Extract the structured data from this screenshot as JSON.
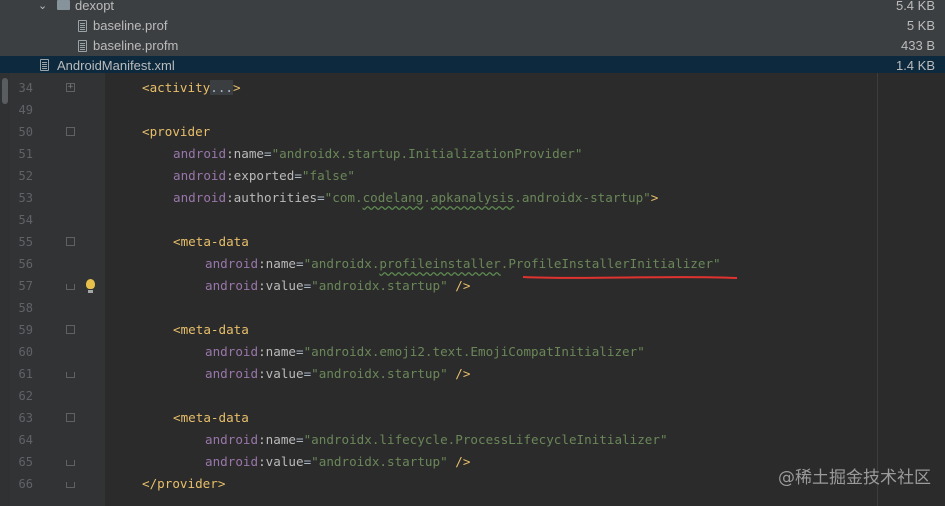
{
  "project_tree": {
    "rows": [
      {
        "name": "dexopt",
        "size": "5.4 KB",
        "type": "folder"
      },
      {
        "name": "baseline.prof",
        "size": "5 KB",
        "type": "file"
      },
      {
        "name": "baseline.profm",
        "size": "433 B",
        "type": "file"
      },
      {
        "name": "AndroidManifest.xml",
        "size": "1.4 KB",
        "type": "file"
      }
    ]
  },
  "editor": {
    "lines": [
      {
        "num": "34",
        "tokens": [
          {
            "t": "<activity",
            "c": "tag"
          },
          {
            "t": "...",
            "c": "dots"
          },
          {
            "t": ">",
            "c": "tag"
          }
        ]
      },
      {
        "num": "49",
        "tokens": []
      },
      {
        "num": "50",
        "tokens": [
          {
            "t": "<provider",
            "c": "tag"
          }
        ]
      },
      {
        "num": "51",
        "tokens": [
          {
            "t": "android",
            "c": "ns"
          },
          {
            "t": ":name",
            "c": "attr"
          },
          {
            "t": "=",
            "c": "eq"
          },
          {
            "t": "\"androidx.startup.InitializationProvider\"",
            "c": "val"
          }
        ]
      },
      {
        "num": "52",
        "tokens": [
          {
            "t": "android",
            "c": "ns"
          },
          {
            "t": ":exported",
            "c": "attr"
          },
          {
            "t": "=",
            "c": "eq"
          },
          {
            "t": "\"false\"",
            "c": "val"
          }
        ]
      },
      {
        "num": "53",
        "tokens": [
          {
            "t": "android",
            "c": "ns"
          },
          {
            "t": ":authorities",
            "c": "attr"
          },
          {
            "t": "=",
            "c": "eq"
          },
          {
            "t": "\"com.",
            "c": "val"
          },
          {
            "t": "codelang",
            "c": "val typo"
          },
          {
            "t": ".",
            "c": "val"
          },
          {
            "t": "apkanalysis",
            "c": "val typo"
          },
          {
            "t": ".androidx-startup\"",
            "c": "val"
          },
          {
            "t": ">",
            "c": "tag"
          }
        ]
      },
      {
        "num": "54",
        "tokens": []
      },
      {
        "num": "55",
        "tokens": [
          {
            "t": "<meta-data",
            "c": "tag"
          }
        ]
      },
      {
        "num": "56",
        "tokens": [
          {
            "t": "android",
            "c": "ns"
          },
          {
            "t": ":name",
            "c": "attr"
          },
          {
            "t": "=",
            "c": "eq"
          },
          {
            "t": "\"androidx.",
            "c": "val"
          },
          {
            "t": "profileinstaller",
            "c": "val typo"
          },
          {
            "t": ".ProfileInstallerInitializer\"",
            "c": "val"
          }
        ]
      },
      {
        "num": "57",
        "tokens": [
          {
            "t": "android",
            "c": "ns"
          },
          {
            "t": ":value",
            "c": "attr"
          },
          {
            "t": "=",
            "c": "eq"
          },
          {
            "t": "\"androidx.startup\"",
            "c": "val"
          },
          {
            "t": " />",
            "c": "tag"
          }
        ]
      },
      {
        "num": "58",
        "tokens": []
      },
      {
        "num": "59",
        "tokens": [
          {
            "t": "<meta-data",
            "c": "tag"
          }
        ]
      },
      {
        "num": "60",
        "tokens": [
          {
            "t": "android",
            "c": "ns"
          },
          {
            "t": ":name",
            "c": "attr"
          },
          {
            "t": "=",
            "c": "eq"
          },
          {
            "t": "\"androidx.emoji2.text.EmojiCompatInitializer\"",
            "c": "val"
          }
        ]
      },
      {
        "num": "61",
        "tokens": [
          {
            "t": "android",
            "c": "ns"
          },
          {
            "t": ":value",
            "c": "attr"
          },
          {
            "t": "=",
            "c": "eq"
          },
          {
            "t": "\"androidx.startup\"",
            "c": "val"
          },
          {
            "t": " />",
            "c": "tag"
          }
        ]
      },
      {
        "num": "62",
        "tokens": []
      },
      {
        "num": "63",
        "tokens": [
          {
            "t": "<meta-data",
            "c": "tag"
          }
        ]
      },
      {
        "num": "64",
        "tokens": [
          {
            "t": "android",
            "c": "ns"
          },
          {
            "t": ":name",
            "c": "attr"
          },
          {
            "t": "=",
            "c": "eq"
          },
          {
            "t": "\"androidx.lifecycle.ProcessLifecycleInitializer\"",
            "c": "val"
          }
        ]
      },
      {
        "num": "65",
        "tokens": [
          {
            "t": "android",
            "c": "ns"
          },
          {
            "t": ":value",
            "c": "attr"
          },
          {
            "t": "=",
            "c": "eq"
          },
          {
            "t": "\"androidx.startup\"",
            "c": "val"
          },
          {
            "t": " />",
            "c": "tag"
          }
        ]
      },
      {
        "num": "66",
        "tokens": [
          {
            "t": "</provider>",
            "c": "tag"
          }
        ]
      }
    ]
  },
  "watermark": "@稀土掘金技术社区",
  "colors": {
    "background": "#2b2b2b",
    "tag": "#e8bf6a",
    "namespace": "#9876aa",
    "string": "#6a8759",
    "annotation_underline": "#e0332f"
  }
}
